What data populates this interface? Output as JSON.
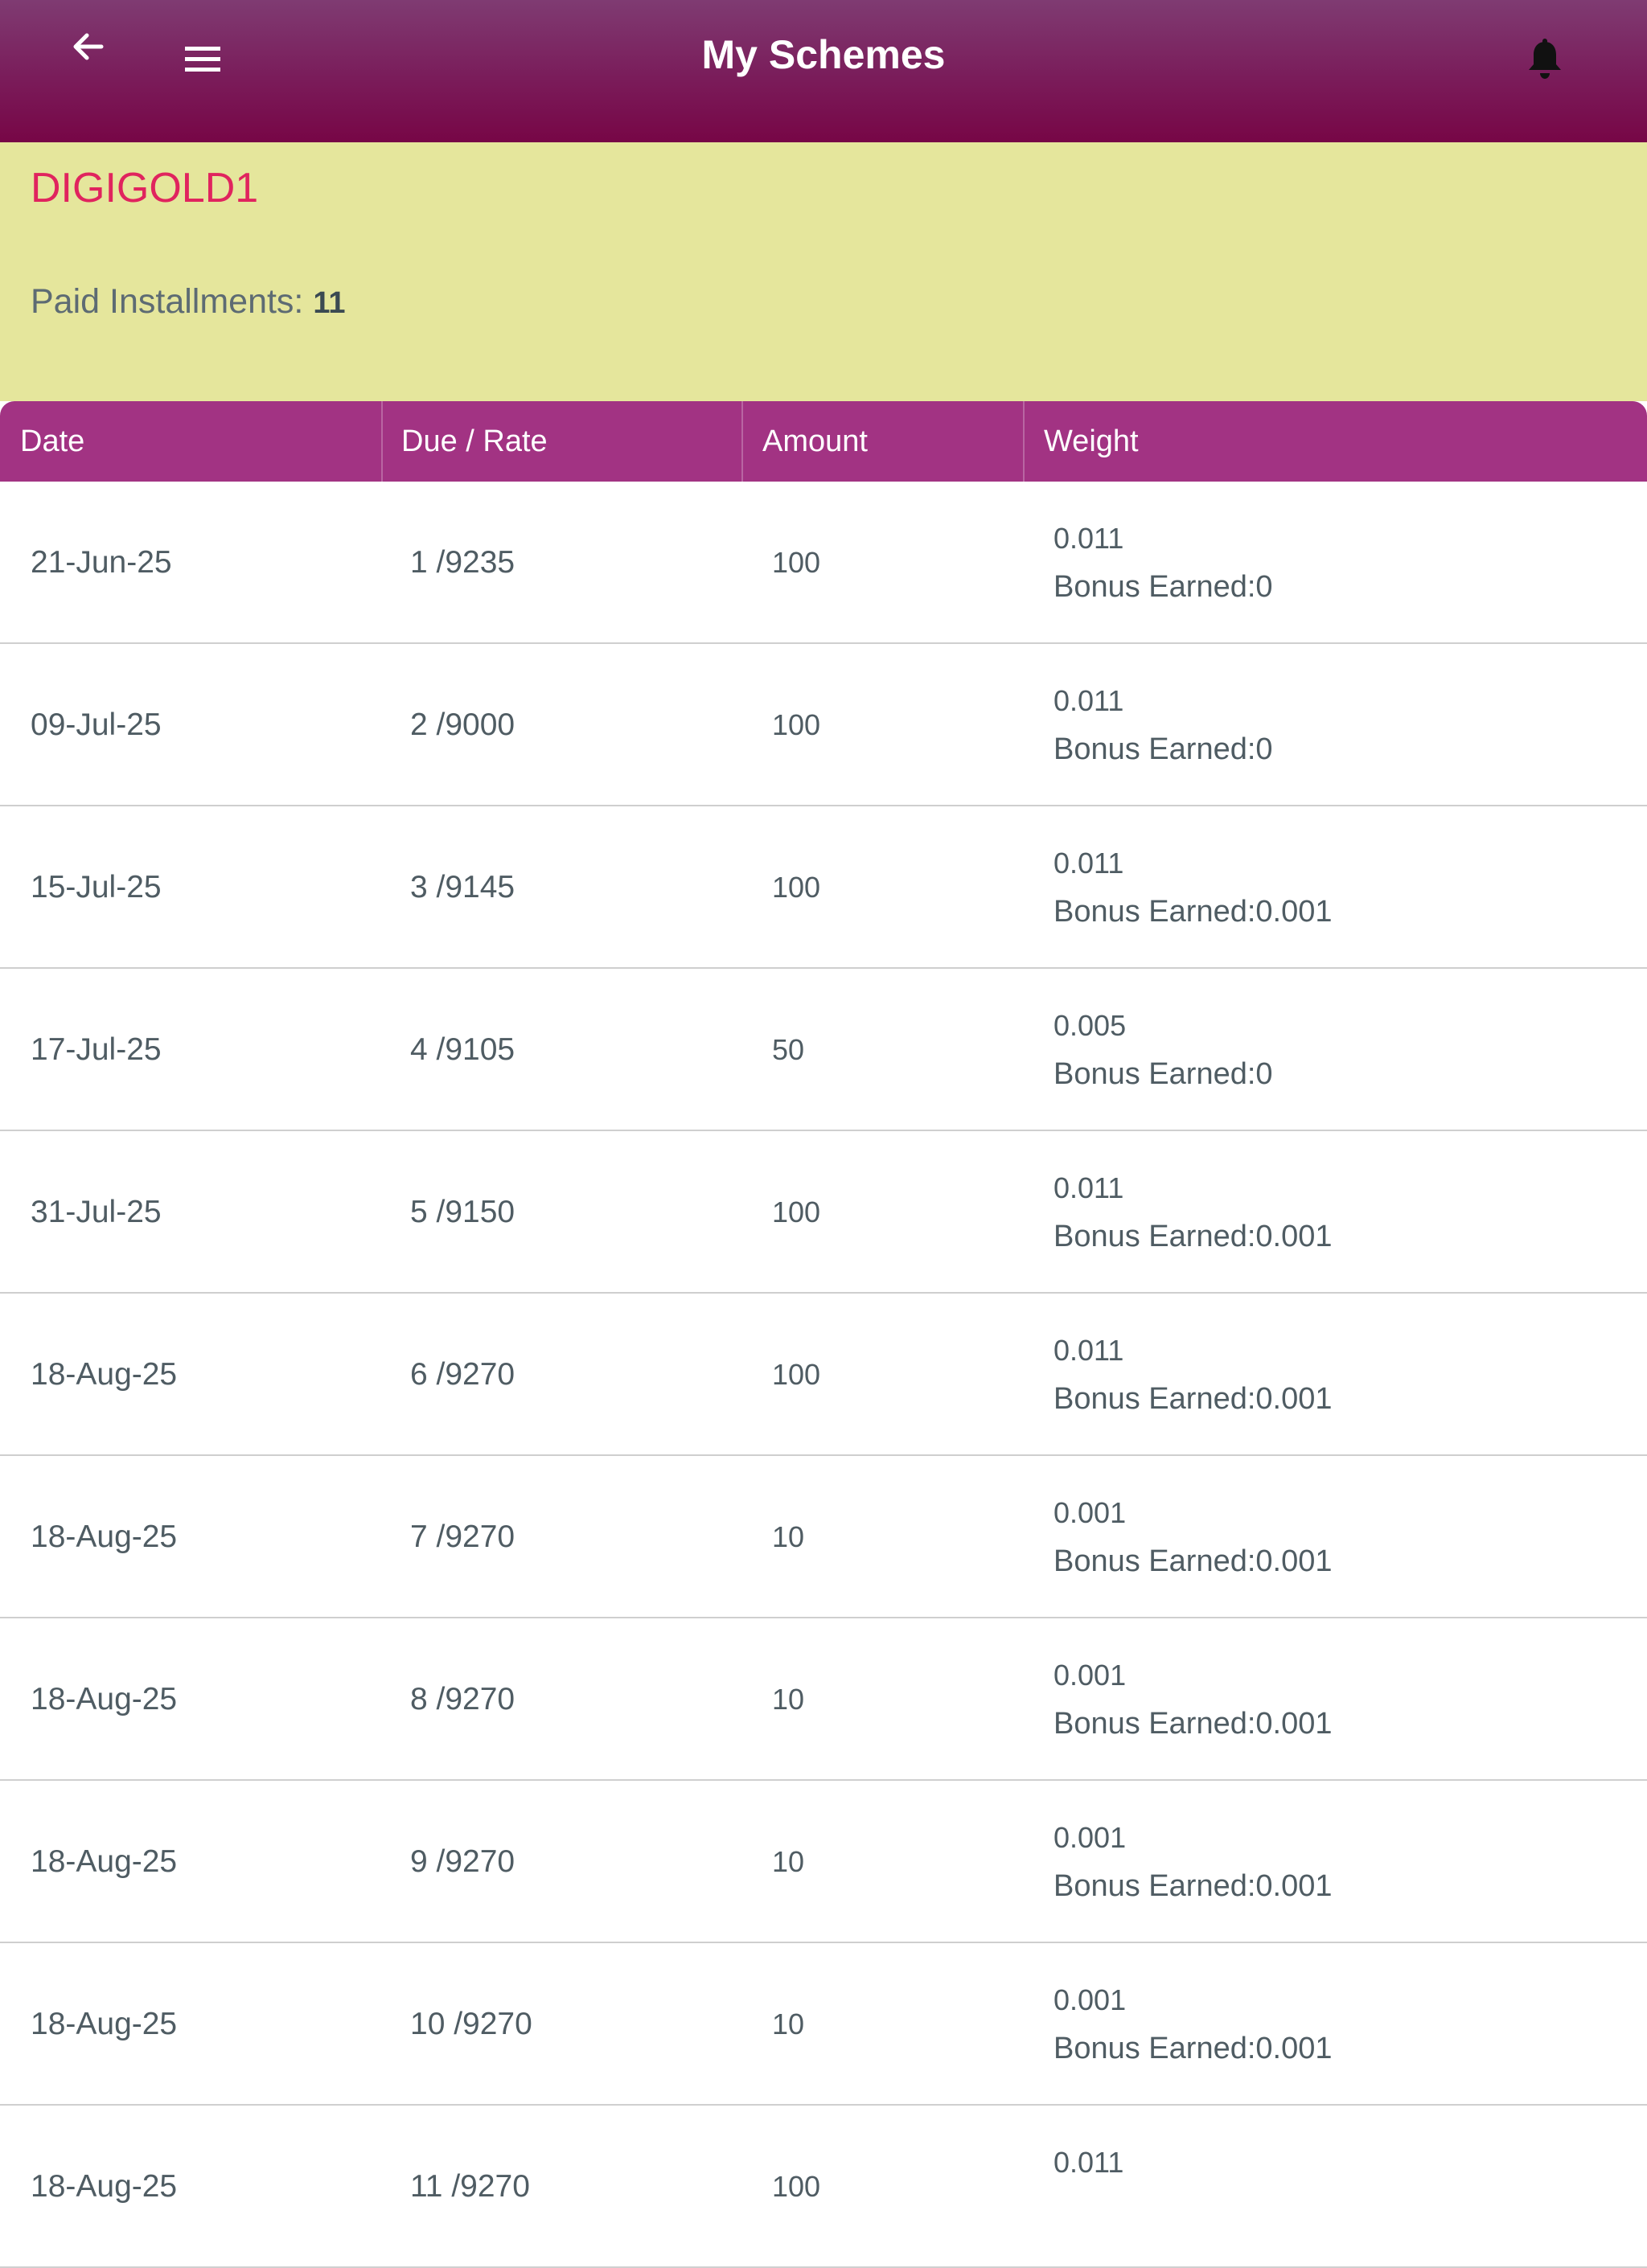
{
  "header": {
    "title": "My Schemes",
    "back_icon": "arrow-left-icon",
    "menu_icon": "hamburger-menu-icon",
    "bell_icon": "notification-bell-icon"
  },
  "scheme": {
    "name": "DIGIGOLD1",
    "paid_label": "Paid Installments:",
    "paid_count": "11"
  },
  "table": {
    "columns": [
      "Date",
      "Due / Rate",
      "Amount",
      "Weight"
    ],
    "rows": [
      {
        "date": "21-Jun-25",
        "due_rate": "1 /9235",
        "amount": "100",
        "weight": "0.011",
        "bonus": "Bonus Earned:0"
      },
      {
        "date": "09-Jul-25",
        "due_rate": "2 /9000",
        "amount": "100",
        "weight": "0.011",
        "bonus": "Bonus Earned:0"
      },
      {
        "date": "15-Jul-25",
        "due_rate": "3 /9145",
        "amount": "100",
        "weight": "0.011",
        "bonus": "Bonus Earned:0.001"
      },
      {
        "date": "17-Jul-25",
        "due_rate": "4 /9105",
        "amount": "50",
        "weight": "0.005",
        "bonus": "Bonus Earned:0"
      },
      {
        "date": "31-Jul-25",
        "due_rate": "5 /9150",
        "amount": "100",
        "weight": "0.011",
        "bonus": "Bonus Earned:0.001"
      },
      {
        "date": "18-Aug-25",
        "due_rate": "6 /9270",
        "amount": "100",
        "weight": "0.011",
        "bonus": "Bonus Earned:0.001"
      },
      {
        "date": "18-Aug-25",
        "due_rate": "7 /9270",
        "amount": "10",
        "weight": "0.001",
        "bonus": "Bonus Earned:0.001"
      },
      {
        "date": "18-Aug-25",
        "due_rate": "8 /9270",
        "amount": "10",
        "weight": "0.001",
        "bonus": "Bonus Earned:0.001"
      },
      {
        "date": "18-Aug-25",
        "due_rate": "9 /9270",
        "amount": "10",
        "weight": "0.001",
        "bonus": "Bonus Earned:0.001"
      },
      {
        "date": "18-Aug-25",
        "due_rate": "10 /9270",
        "amount": "10",
        "weight": "0.001",
        "bonus": "Bonus Earned:0.001"
      },
      {
        "date": "18-Aug-25",
        "due_rate": "11 /9270",
        "amount": "100",
        "weight": "0.011",
        "bonus": ""
      }
    ]
  },
  "colors": {
    "header_top": "#7f3b72",
    "header_bottom": "#770646",
    "summary_bg": "#e5e69c",
    "scheme_name": "#e0245e",
    "table_header": "#a23383"
  }
}
